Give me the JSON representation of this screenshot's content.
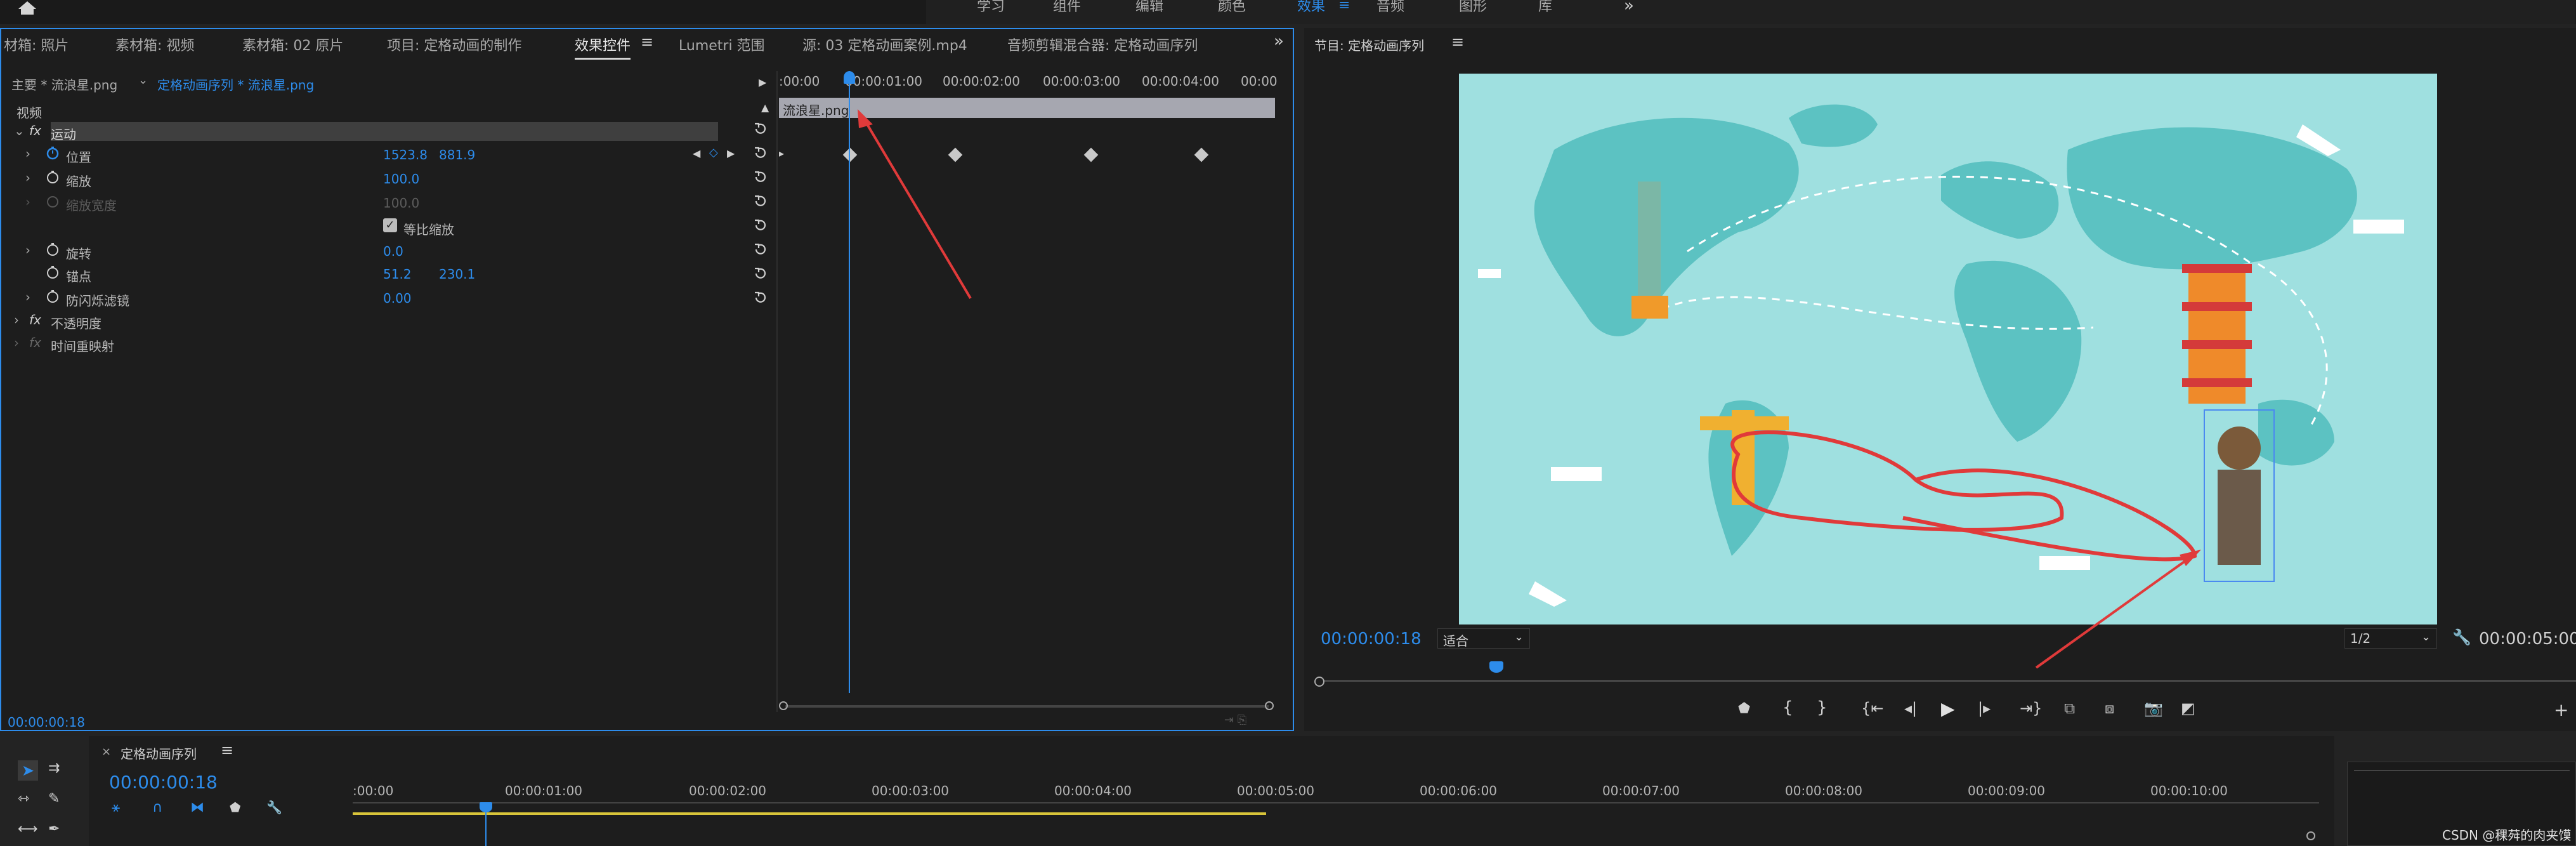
{
  "top_workspaces": {
    "learning": "学习",
    "assembly": "组件",
    "editing": "编辑",
    "color": "颜色",
    "effects": "效果",
    "audio": "音频",
    "graphics": "图形",
    "libraries": "库"
  },
  "top_tabs": [
    {
      "label": "材箱: 照片"
    },
    {
      "label": "素材箱: 视频"
    },
    {
      "label": "素材箱: 02 原片"
    },
    {
      "label": "项目: 定格动画的制作"
    },
    {
      "label": "效果控件"
    },
    {
      "label": "Lumetri 范围"
    },
    {
      "label": "源: 03 定格动画案例.mp4"
    },
    {
      "label": "音频剪辑混合器: 定格动画序列"
    }
  ],
  "effect_controls": {
    "master_clip": "主要 * 流浪星.png",
    "sequence_clip": "定格动画序列 * 流浪星.png",
    "video_header": "视频",
    "motion": "运动",
    "position_label": "位置",
    "position_x": "1523.8",
    "position_y": "881.9",
    "scale_label": "缩放",
    "scale_value": "100.0",
    "scale_width_label": "缩放宽度",
    "scale_width_value": "100.0",
    "uniform_scale_label": "等比缩放",
    "rotation_label": "旋转",
    "rotation_value": "0.0",
    "anchor_label": "锚点",
    "anchor_x": "51.2",
    "anchor_y": "230.1",
    "flicker_label": "防闪烁滤镜",
    "flicker_value": "0.00",
    "opacity_label": "不透明度",
    "time_remap_label": "时间重映射",
    "current_time": "00:00:00:18",
    "clip_name": "流浪星.png",
    "ruler": [
      ":00:00",
      "00:00:01:00",
      "00:00:02:00",
      "00:00:03:00",
      "00:00:04:00",
      "00:00"
    ]
  },
  "program": {
    "title": "节目: 定格动画序列",
    "timecode": "00:00:00:18",
    "fit": "适合",
    "resolution": "1/2",
    "duration": "00:00:05:00"
  },
  "timeline": {
    "title": "定格动画序列",
    "timecode": "00:00:00:18",
    "ruler": [
      ":00:00",
      "00:00:01:00",
      "00:00:02:00",
      "00:00:03:00",
      "00:00:04:00",
      "00:00:05:00",
      "00:00:06:00",
      "00:00:07:00",
      "00:00:08:00",
      "00:00:09:00",
      "00:00:10:00"
    ]
  },
  "watermark": "CSDN @稞荈的肉夹馍",
  "colors": {
    "accent": "#2d8ceb",
    "annotation": "#e03a3a",
    "map_bg": "#9fe0e0",
    "map_land": "#5cc2c2"
  }
}
